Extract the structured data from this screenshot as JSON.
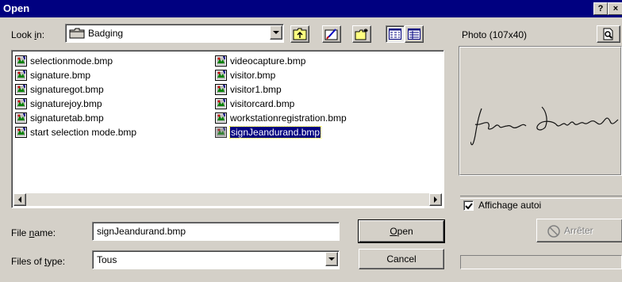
{
  "window": {
    "title": "Open",
    "help_label": "?",
    "close_label": "×"
  },
  "look_in": {
    "label_pre": "Look ",
    "label_ul": "i",
    "label_post": "n:",
    "value": "Badging"
  },
  "files": [
    {
      "name": "selectionmode.bmp",
      "selected": false
    },
    {
      "name": "signature.bmp",
      "selected": false
    },
    {
      "name": "signaturegot.bmp",
      "selected": false
    },
    {
      "name": "signaturejoy.bmp",
      "selected": false
    },
    {
      "name": "signaturetab.bmp",
      "selected": false
    },
    {
      "name": "start selection mode.bmp",
      "selected": false
    },
    {
      "name": "videocapture.bmp",
      "selected": false
    },
    {
      "name": "visitor.bmp",
      "selected": false
    },
    {
      "name": "visitor1.bmp",
      "selected": false
    },
    {
      "name": "visitorcard.bmp",
      "selected": false
    },
    {
      "name": "workstationregistration.bmp",
      "selected": false
    },
    {
      "name": "signJeandurand.bmp",
      "selected": true
    }
  ],
  "file_name": {
    "label_pre": "File ",
    "label_ul": "n",
    "label_post": "ame:",
    "value": "signJeandurand.bmp"
  },
  "file_type": {
    "label_pre": "Files of ",
    "label_ul": "t",
    "label_post": "ype:",
    "value": "Tous"
  },
  "buttons": {
    "open_ul": "O",
    "open_rest": "pen",
    "cancel": "Cancel"
  },
  "preview": {
    "title": "Photo (107x40)",
    "auto_label": "Affichage autoi",
    "auto_checked": true,
    "stop_label": "Arrêter"
  },
  "colors": {
    "title_bar": "#000080",
    "face": "#d4d0c8",
    "selection": "#000080"
  },
  "icons": [
    "folder-icon",
    "up-folder-icon",
    "new-folder-icon",
    "desktop-icon",
    "list-view-icon",
    "details-view-icon",
    "preview-icon",
    "bitmap-file-icon",
    "stop-icon"
  ]
}
